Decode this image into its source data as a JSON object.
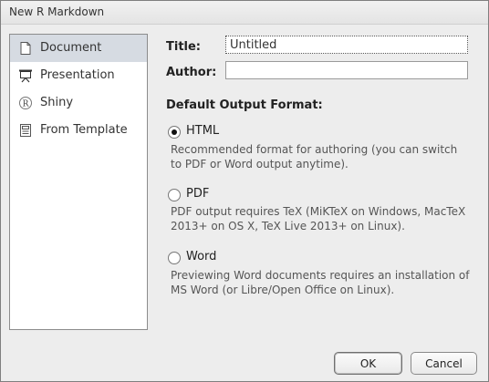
{
  "window": {
    "title": "New R Markdown"
  },
  "sidebar": {
    "items": [
      {
        "label": "Document",
        "icon": "document-icon"
      },
      {
        "label": "Presentation",
        "icon": "presentation-icon"
      },
      {
        "label": "Shiny",
        "icon": "shiny-icon"
      },
      {
        "label": "From Template",
        "icon": "template-icon"
      }
    ],
    "selected": "Document"
  },
  "form": {
    "title_label": "Title:",
    "title_value": "Untitled",
    "author_label": "Author:",
    "author_value": ""
  },
  "output": {
    "section_title": "Default Output Format:",
    "options": [
      {
        "label": "HTML",
        "checked": true,
        "description": "Recommended format for authoring (you can switch to PDF or Word output anytime)."
      },
      {
        "label": "PDF",
        "checked": false,
        "description": "PDF output requires TeX (MiKTeX on Windows, MacTeX 2013+ on OS X, TeX Live 2013+ on Linux)."
      },
      {
        "label": "Word",
        "checked": false,
        "description": "Previewing Word documents requires an installation of MS Word (or Libre/Open Office on Linux)."
      }
    ]
  },
  "buttons": {
    "ok": "OK",
    "cancel": "Cancel"
  }
}
